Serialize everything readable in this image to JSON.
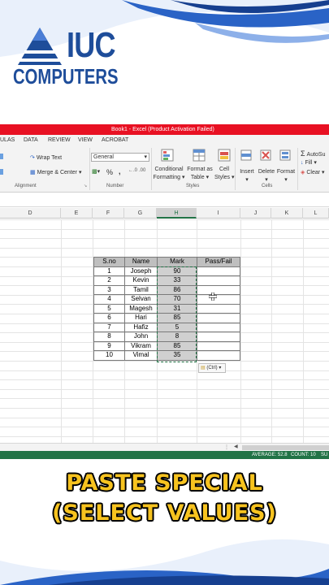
{
  "logo": {
    "line1": "IUC",
    "line2": "COMPUTERS"
  },
  "excel": {
    "title": "Book1 - Excel (Product Activation Failed)",
    "tabs": [
      "ULAS",
      "DATA",
      "REVIEW",
      "VIEW",
      "ACROBAT"
    ],
    "ribbon": {
      "wrap_text": "Wrap Text",
      "merge_center": "Merge & Center",
      "number_format": "General",
      "percent": "%",
      "comma": ",",
      "conditional_formatting": [
        "Conditional",
        "Formatting"
      ],
      "format_as_table": [
        "Format as",
        "Table"
      ],
      "cell_styles": [
        "Cell",
        "Styles"
      ],
      "insert": "Insert",
      "delete": "Delete",
      "format": "Format",
      "autosum": "AutoSu",
      "fill": "Fill",
      "clear": "Clear",
      "groups": {
        "alignment": "Alignment",
        "number": "Number",
        "styles": "Styles",
        "cells": "Cells"
      }
    },
    "columns": [
      "D",
      "E",
      "F",
      "G",
      "H",
      "I",
      "J",
      "K",
      "L"
    ],
    "selected_column": "H",
    "table": {
      "headers": [
        "S.no",
        "Name",
        "Mark",
        "Pass/Fail"
      ],
      "rows": [
        {
          "sno": "1",
          "name": "Joseph",
          "mark": "90"
        },
        {
          "sno": "2",
          "name": "Kevin",
          "mark": "33"
        },
        {
          "sno": "3",
          "name": "Tamil",
          "mark": "86"
        },
        {
          "sno": "4",
          "name": "Selvan",
          "mark": "70"
        },
        {
          "sno": "5",
          "name": "Magesh",
          "mark": "31"
        },
        {
          "sno": "6",
          "name": "Hari",
          "mark": "85"
        },
        {
          "sno": "7",
          "name": "Hafiz",
          "mark": "5"
        },
        {
          "sno": "8",
          "name": "John",
          "mark": "8"
        },
        {
          "sno": "9",
          "name": "Vikram",
          "mark": "85"
        },
        {
          "sno": "10",
          "name": "Vimal",
          "mark": "35"
        }
      ]
    },
    "paste_options_label": "(Ctrl)",
    "status": {
      "average": "AVERAGE: 52.8",
      "count": "COUNT: 10",
      "sum": "SU"
    }
  },
  "caption": {
    "line1": "PASTE SPECIAL",
    "line2": "(SELECT VALUES)"
  },
  "colors": {
    "excel_red": "#e81123",
    "excel_green": "#217346",
    "logo_blue": "#1e4d9a",
    "caption_yellow": "#f7c31f"
  }
}
